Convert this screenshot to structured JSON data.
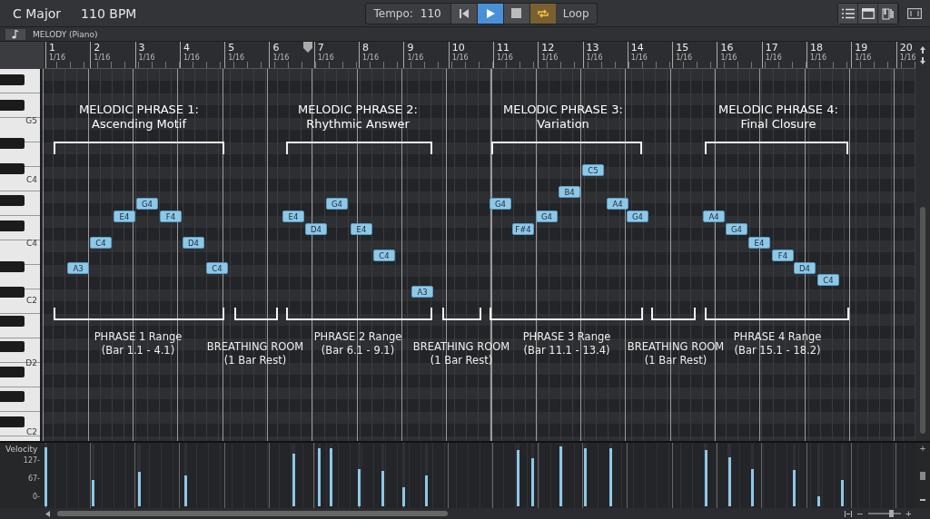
{
  "header": {
    "key": "C Major",
    "tempo_display": "110 BPM"
  },
  "transport": {
    "tempo_label": "Tempo:",
    "tempo_value": "110",
    "play_selected": true,
    "loop_on": true,
    "loop_label": "Loop"
  },
  "track": {
    "name": "MELODY (Piano)"
  },
  "ruler": [
    {
      "bar": "1",
      "division": "1/16"
    },
    {
      "bar": "2",
      "division": "1/16"
    },
    {
      "bar": "3",
      "division": "1/16"
    },
    {
      "bar": "4",
      "division": "1/16"
    },
    {
      "bar": "5",
      "division": "1/16"
    },
    {
      "bar": "6",
      "division": "1/16"
    },
    {
      "bar": "7",
      "division": "1/16"
    },
    {
      "bar": "8",
      "division": "1/16"
    },
    {
      "bar": "9",
      "division": "1/16"
    },
    {
      "bar": "10",
      "division": "1/16"
    },
    {
      "bar": "11",
      "division": "1/16"
    },
    {
      "bar": "12",
      "division": "1/16"
    },
    {
      "bar": "13",
      "division": "1/16"
    },
    {
      "bar": "14",
      "division": "1/16"
    },
    {
      "bar": "15",
      "division": "1/16"
    },
    {
      "bar": "16",
      "division": "1/16"
    },
    {
      "bar": "17",
      "division": "1/16"
    },
    {
      "bar": "18",
      "division": "1/16"
    },
    {
      "bar": "19",
      "division": "1/16"
    },
    {
      "bar": "20",
      "division": "1/16"
    }
  ],
  "keyboard_labels": [
    "G5",
    "C4",
    "C4",
    "C2",
    "D2",
    "C2"
  ],
  "phrases": [
    {
      "title": "MELODIC PHRASE 1:",
      "subtitle": "Ascending Motif",
      "notes": [
        "A3",
        "C4",
        "E4",
        "G4",
        "F4",
        "D4",
        "C4"
      ],
      "range_title": "PHRASE 1 Range",
      "range": "(Bar 1.1 - 4.1)"
    },
    {
      "title": "MELODIC PHRASE 2:",
      "subtitle": "Rhythmic Answer",
      "notes": [
        "E4",
        "D4",
        "G4",
        "E4",
        "C4",
        "A3"
      ],
      "range_title": "PHRASE 2 Range",
      "range": "(Bar 6.1 - 9.1)"
    },
    {
      "title": "MELODIC PHRASE 3:",
      "subtitle": "Variation",
      "notes": [
        "G4",
        "F#4",
        "G4",
        "B4",
        "C5",
        "A4",
        "G4"
      ],
      "range_title": "PHRASE 3 Range",
      "range": "(Bar 11.1 - 13.4)"
    },
    {
      "title": "MELODIC PHRASE 4:",
      "subtitle": "Final Closure",
      "notes": [
        "A4",
        "G4",
        "E4",
        "F4",
        "D4",
        "C4"
      ],
      "range_title": "PHRASE 4 Range",
      "range": "(Bar 15.1 - 18.2)"
    }
  ],
  "rests": [
    {
      "title": "BREATHING ROOM",
      "subtitle": "(1 Bar Rest)"
    },
    {
      "title": "BREATHING ROOM",
      "subtitle": "(1 Bar Rest)"
    },
    {
      "title": "BREATHING ROOM",
      "subtitle": "(1 Bar Rest)"
    }
  ],
  "velocity": {
    "label": "Velocity",
    "ticks": [
      "127-",
      "67-",
      "0-"
    ],
    "bars": [
      {
        "level": 0.98
      },
      {
        "level": 0.44
      },
      {
        "level": 0.58
      },
      {
        "level": 0.52
      },
      {
        "level": 0.88
      },
      {
        "level": 0.97
      },
      {
        "level": 0.97
      },
      {
        "level": 0.62
      },
      {
        "level": 0.59
      },
      {
        "level": 0.32
      },
      {
        "level": 0.52
      },
      {
        "level": 0.94
      },
      {
        "level": 0.8
      },
      {
        "level": 1.0
      },
      {
        "level": 0.97
      },
      {
        "level": 0.97
      },
      {
        "level": 0.94
      },
      {
        "level": 0.82
      },
      {
        "level": 0.62
      },
      {
        "level": 0.61
      },
      {
        "level": 0.17
      },
      {
        "level": 0.44
      }
    ]
  },
  "lane_zoom": {
    "plus": "+"
  },
  "zoom": {
    "minus": "−",
    "plus": "+",
    "level": 0.7
  }
}
